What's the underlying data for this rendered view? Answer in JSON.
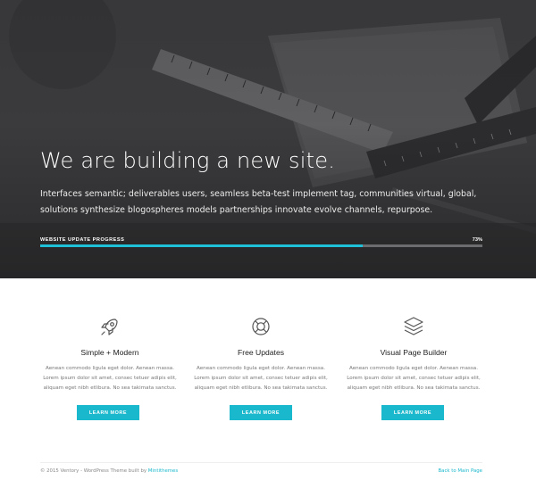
{
  "hero": {
    "title": "We are building a new site.",
    "description": "Interfaces semantic; deliverables users, seamless beta-test implement tag, communities virtual, global, solutions synthesize blogospheres models partnerships innovate evolve channels, repurpose.",
    "progress_label": "WEBSITE UPDATE PROGRESS",
    "progress_text": "73%",
    "progress_fraction": 0.73,
    "background_image": "desk-with-rulers-notebook-photo"
  },
  "features": [
    {
      "icon": "rocket-icon",
      "title": "Simple + Modern",
      "text": "Aenean commodo ligula eget dolor. Aenean massa. Lorem ipsum dolor sit amet, consec tetuer adipis elit, aliquam eget nibh etlibura. No sea takimata sanctus.",
      "button": "LEARN MORE"
    },
    {
      "icon": "lifebuoy-icon",
      "title": "Free Updates",
      "text": "Aenean commodo ligula eget dolor. Aenean massa. Lorem ipsum dolor sit amet, consec tetuer adipis elit, aliquam eget nibh etlibura. No sea takimata sanctus.",
      "button": "LEARN MORE"
    },
    {
      "icon": "layers-icon",
      "title": "Visual Page Builder",
      "text": "Aenean commodo ligula eget dolor. Aenean massa. Lorem ipsum dolor sit amet, consec tetuer adipis elit, aliquam eget nibh etlibura. No sea takimata sanctus.",
      "button": "LEARN MORE"
    }
  ],
  "footer": {
    "copyright": "© 2015 Ventory - WordPress Theme built by ",
    "author_link": "Mintithemes",
    "back_link": "Back to Main Page"
  },
  "colors": {
    "accent": "#1ab8cc",
    "hero_overlay": "#3f3f41",
    "progress_track": "#6c6c6e"
  }
}
